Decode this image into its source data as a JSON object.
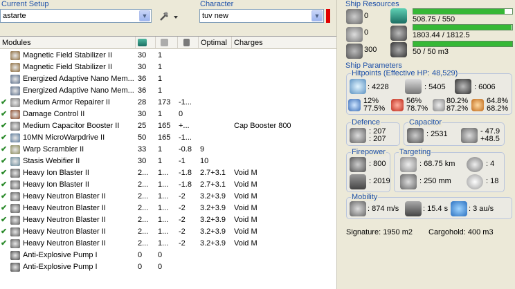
{
  "setup": {
    "label": "Current Setup",
    "value": "astarte"
  },
  "character": {
    "label": "Character",
    "value": "tuv new"
  },
  "columns": [
    "Modules",
    "",
    "",
    "",
    "Optimal",
    "Charges"
  ],
  "modules": [
    {
      "checked": false,
      "name": "Magnetic Field Stabilizer II",
      "c1": "30",
      "c2": "1",
      "c3": "",
      "optimal": "",
      "charges": ""
    },
    {
      "checked": false,
      "name": "Magnetic Field Stabilizer II",
      "c1": "30",
      "c2": "1",
      "c3": "",
      "optimal": "",
      "charges": ""
    },
    {
      "checked": false,
      "name": "Energized Adaptive Nano Mem...",
      "c1": "36",
      "c2": "1",
      "c3": "",
      "optimal": "",
      "charges": ""
    },
    {
      "checked": false,
      "name": "Energized Adaptive Nano Mem...",
      "c1": "36",
      "c2": "1",
      "c3": "",
      "optimal": "",
      "charges": ""
    },
    {
      "checked": true,
      "name": "Medium Armor Repairer II",
      "c1": "28",
      "c2": "173",
      "c3": "-1...",
      "optimal": "",
      "charges": ""
    },
    {
      "checked": true,
      "name": "Damage Control II",
      "c1": "30",
      "c2": "1",
      "c3": "0",
      "optimal": "",
      "charges": ""
    },
    {
      "checked": true,
      "name": "Medium Capacitor Booster II",
      "c1": "25",
      "c2": "165",
      "c3": "+...",
      "optimal": "",
      "charges": "Cap Booster 800"
    },
    {
      "checked": true,
      "name": "10MN MicroWarpdrive II",
      "c1": "50",
      "c2": "165",
      "c3": "-1...",
      "optimal": "",
      "charges": ""
    },
    {
      "checked": true,
      "name": "Warp Scrambler II",
      "c1": "33",
      "c2": "1",
      "c3": "-0.8",
      "optimal": "9",
      "charges": ""
    },
    {
      "checked": true,
      "name": "Stasis Webifier II",
      "c1": "30",
      "c2": "1",
      "c3": "-1",
      "optimal": "10",
      "charges": ""
    },
    {
      "checked": true,
      "name": "Heavy Ion Blaster II",
      "c1": "2...",
      "c2": "1...",
      "c3": "-1.8",
      "optimal": "2.7+3.1",
      "charges": "Void M"
    },
    {
      "checked": true,
      "name": "Heavy Ion Blaster II",
      "c1": "2...",
      "c2": "1...",
      "c3": "-1.8",
      "optimal": "2.7+3.1",
      "charges": "Void M"
    },
    {
      "checked": true,
      "name": "Heavy Neutron Blaster II",
      "c1": "2...",
      "c2": "1...",
      "c3": "-2",
      "optimal": "3.2+3.9",
      "charges": "Void M"
    },
    {
      "checked": true,
      "name": "Heavy Neutron Blaster II",
      "c1": "2...",
      "c2": "1...",
      "c3": "-2",
      "optimal": "3.2+3.9",
      "charges": "Void M"
    },
    {
      "checked": true,
      "name": "Heavy Neutron Blaster II",
      "c1": "2...",
      "c2": "1...",
      "c3": "-2",
      "optimal": "3.2+3.9",
      "charges": "Void M"
    },
    {
      "checked": true,
      "name": "Heavy Neutron Blaster II",
      "c1": "2...",
      "c2": "1...",
      "c3": "-2",
      "optimal": "3.2+3.9",
      "charges": "Void M"
    },
    {
      "checked": true,
      "name": "Heavy Neutron Blaster II",
      "c1": "2...",
      "c2": "1...",
      "c3": "-2",
      "optimal": "3.2+3.9",
      "charges": "Void M"
    },
    {
      "checked": false,
      "name": "Anti-Explosive Pump I",
      "c1": "0",
      "c2": "0",
      "c3": "",
      "optimal": "",
      "charges": ""
    },
    {
      "checked": false,
      "name": "Anti-Explosive Pump I",
      "c1": "0",
      "c2": "0",
      "c3": "",
      "optimal": "",
      "charges": ""
    }
  ],
  "resources": {
    "label": "Ship Resources",
    "hardpoints": [
      {
        "value": "0"
      },
      {
        "value": "0"
      },
      {
        "value": "300"
      }
    ],
    "cpu": {
      "text": "508.75 / 550",
      "fraction": 0.925
    },
    "power": {
      "text": "1803.44 / 1812.5",
      "fraction": 0.995
    },
    "drone": {
      "text": "50 / 50 m3",
      "fraction": 1.0
    }
  },
  "params": {
    "label": "Ship Parameters",
    "hitpoints": {
      "label": "Hitpoints (Effective HP: 48,529)",
      "shield_hp": ": 4228",
      "armor_hp": ": 5405",
      "structure_hp": ": 6006",
      "res1a": "12%",
      "res1b": "77.5%",
      "res2a": "56%",
      "res2b": "78.7%",
      "res3a": "80.2%",
      "res3b": "87.2%",
      "res4a": "64.8%",
      "res4b": "68.2%"
    },
    "defence": {
      "label": "Defence",
      "a": ": 207",
      "b": ": 207"
    },
    "capacitor": {
      "label": "Capacitor",
      "value": ": 2531",
      "delta1": "- 47.9",
      "delta2": "+48.5"
    },
    "firepower": {
      "label": "Firepower",
      "a": ": 800",
      "b": ": 2019"
    },
    "targeting": {
      "label": "Targeting",
      "range": ": 68.75 km",
      "targets": ": 4",
      "res": ": 250 mm",
      "sensor": ": 18"
    },
    "mobility": {
      "label": "Mobility",
      "speed": ": 874 m/s",
      "align": ": 15.4 s",
      "warp": ": 3 au/s"
    },
    "signature": "Signature: 1950 m2",
    "cargohold": "Cargohold: 400 m3"
  }
}
